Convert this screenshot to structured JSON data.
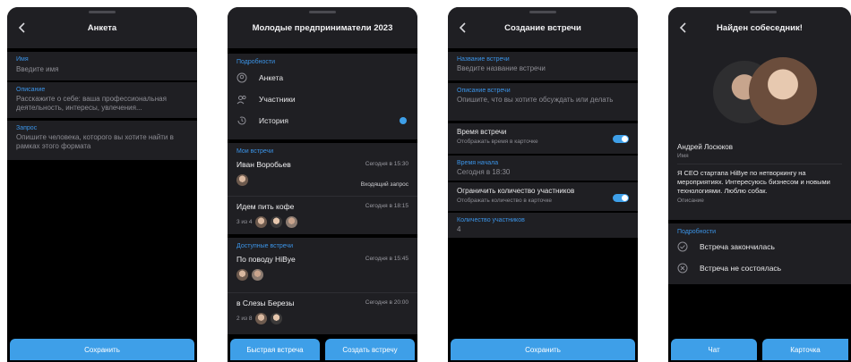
{
  "screen1": {
    "title": "Анкета",
    "fields": [
      {
        "label": "Имя",
        "placeholder": "Введите имя"
      },
      {
        "label": "Описание",
        "placeholder": "Расскажите о себе: ваша профессиональная деятельность, интересы, увлечения..."
      },
      {
        "label": "Запрос",
        "placeholder": "Опишите человека, которого вы хотите найти в рамках этого формата"
      }
    ],
    "save_label": "Сохранить"
  },
  "screen2": {
    "title": "Молодые предприниматели 2023",
    "details_label": "Подробности",
    "details_items": [
      {
        "label": "Анкета",
        "icon": "person-icon"
      },
      {
        "label": "Участники",
        "icon": "users-icon"
      },
      {
        "label": "История",
        "icon": "history-icon"
      }
    ],
    "my_meetings_label": "Мои встречи",
    "my_meetings": [
      {
        "title": "Иван Воробьев",
        "time": "Сегодня в 15:30",
        "status": "Входящий запрос"
      },
      {
        "title": "Идем пить кофе",
        "time": "Сегодня в 18:15",
        "count": "3 из 4"
      }
    ],
    "available_label": "Доступные встречи",
    "available": [
      {
        "title": "По поводу HiBye",
        "time": "Сегодня в 15:45"
      },
      {
        "title": "в Слезы Березы",
        "time": "Сегодня в 20:00",
        "count": "2 из 8"
      }
    ],
    "quick_label": "Быстрая встреча",
    "create_label": "Создать встречу"
  },
  "screen3": {
    "title": "Создание встречи",
    "name_label": "Название встречи",
    "name_placeholder": "Введите название встречи",
    "desc_label": "Описание встречи",
    "desc_placeholder": "Опишите, что вы хотите обсуждать или делать",
    "time_toggle_title": "Время встречи",
    "time_toggle_hint": "Отображать время в карточке",
    "start_label": "Время начала",
    "start_value": "Сегодня в 18:30",
    "limit_toggle_title": "Ограничить количество участников",
    "limit_toggle_hint": "Отображать количество в карточке",
    "count_label": "Количество участников",
    "count_value": "4",
    "save_label": "Сохранить"
  },
  "screen4": {
    "title": "Найден собеседник!",
    "name": "Андрей Лосюков",
    "name_caption": "Имя",
    "about": "Я CEO стартапа HiBye по нетворкингу на мероприятиях. Интересуюсь бизнесом и новыми технологиями. Люблю собак.",
    "about_caption": "Описание",
    "details_label": "Подробности",
    "options": [
      {
        "label": "Встреча закончилась",
        "icon": "check-circle-icon"
      },
      {
        "label": "Встреча не состоялась",
        "icon": "x-circle-icon"
      }
    ],
    "chat_label": "Чат",
    "card_label": "Карточка"
  },
  "colors": {
    "accent": "#3e9fe8",
    "surface": "#1f1f23",
    "background": "#000000"
  }
}
